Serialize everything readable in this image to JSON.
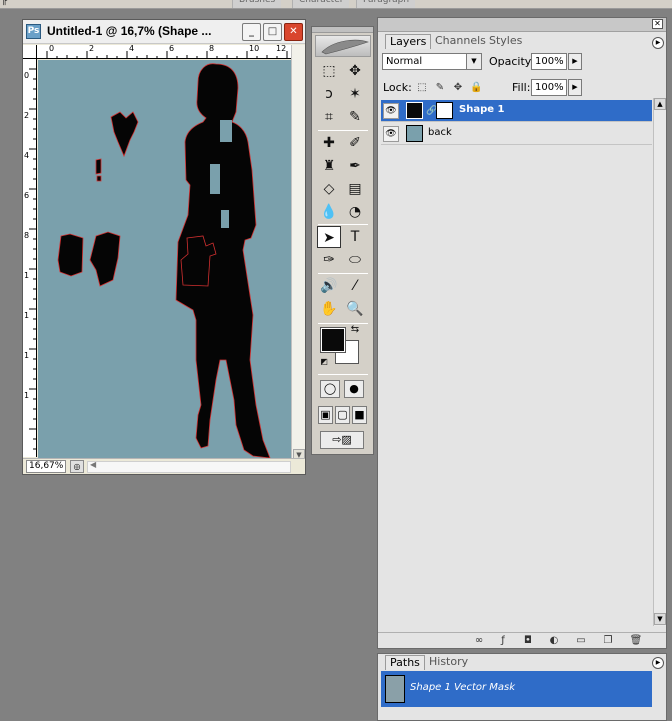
{
  "top_strip": {
    "tabs": [
      "Brushes",
      "Character",
      "Paragraph"
    ]
  },
  "document": {
    "title": "Untitled-1 @ 16,7% (Shape ...",
    "zoom": "16,67%",
    "ruler_h": [
      "0",
      "2",
      "4",
      "6",
      "8",
      "10",
      "12"
    ],
    "ruler_v": [
      "0",
      "2",
      "4",
      "6",
      "8",
      "1",
      "1",
      "1",
      "1"
    ],
    "canvas_color": "#7aa0ac"
  },
  "layers_panel": {
    "tabs": [
      "Layers",
      "Channels",
      "Styles"
    ],
    "blend_mode": "Normal",
    "opacity_label": "Opacity:",
    "opacity_value": "100%",
    "lock_label": "Lock:",
    "fill_label": "Fill:",
    "fill_value": "100%",
    "layers": [
      {
        "name": "Shape 1",
        "selected": true
      },
      {
        "name": "back",
        "selected": false
      }
    ],
    "accent": "#2f6cc8"
  },
  "paths_panel": {
    "tabs": [
      "Paths",
      "History"
    ],
    "items": [
      {
        "name": "Shape 1 Vector Mask"
      }
    ]
  },
  "toolbox": {
    "tools": [
      "marquee-tool",
      "move-tool",
      "lasso-tool",
      "magic-wand-tool",
      "crop-tool",
      "slice-tool",
      "healing-brush-tool",
      "brush-tool",
      "clone-stamp-tool",
      "history-brush-tool",
      "eraser-tool",
      "gradient-tool",
      "blur-tool",
      "dodge-tool",
      "path-selection-tool",
      "type-tool",
      "pen-tool",
      "shape-tool",
      "notes-tool",
      "eyedropper-tool",
      "hand-tool",
      "zoom-tool"
    ],
    "foreground": "#0a0a0a",
    "background": "#ffffff"
  }
}
